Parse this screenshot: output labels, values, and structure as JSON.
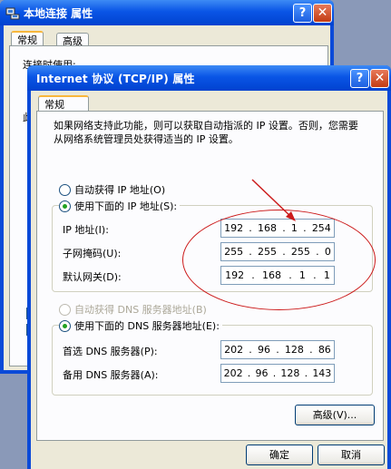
{
  "bg_window": {
    "title": "本地连接 属性",
    "tabs": [
      "常规",
      "高级"
    ],
    "peek_labels": [
      "连接时使用:",
      "此"
    ],
    "help_glyph": "?",
    "close_glyph": "✕"
  },
  "fg_window": {
    "title": "Internet 协议 (TCP/IP) 属性",
    "tab": "常规",
    "description": "如果网络支持此功能，则可以获取自动指派的 IP 设置。否则，您需要从网络系统管理员处获得适当的 IP 设置。",
    "ip_auto_label": "自动获得 IP 地址(O)",
    "ip_manual_label": "使用下面的 IP 地址(S):",
    "ip_address_label": "IP 地址(I):",
    "subnet_label": "子网掩码(U):",
    "gateway_label": "默认网关(D):",
    "ip_address": [
      "192",
      "168",
      "1",
      "254"
    ],
    "subnet_mask": [
      "255",
      "255",
      "255",
      "0"
    ],
    "gateway": [
      "192",
      "168",
      "1",
      "1"
    ],
    "dns_auto_label": "自动获得 DNS 服务器地址(B)",
    "dns_manual_label": "使用下面的 DNS 服务器地址(E):",
    "dns_primary_label": "首选 DNS 服务器(P):",
    "dns_alternate_label": "备用 DNS 服务器(A):",
    "dns_primary": [
      "202",
      "96",
      "128",
      "86"
    ],
    "dns_alternate": [
      "202",
      "96",
      "128",
      "143"
    ],
    "advanced_button": "高级(V)...",
    "ok_button": "确定",
    "cancel_button": "取消",
    "help_glyph": "?",
    "close_glyph": "✕"
  },
  "colors": {
    "title_bar": "#0a55e6",
    "dialog_face": "#ece9d8",
    "annotation": "#cc1b1b"
  },
  "icons": [
    "network-connection-icon"
  ]
}
